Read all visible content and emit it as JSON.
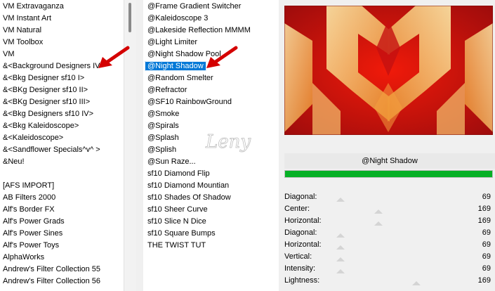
{
  "left_list": {
    "items": [
      "VM Extravaganza",
      "VM Instant Art",
      "VM Natural",
      "VM Toolbox",
      "VM",
      "&<Background Designers IV>",
      "&<Bkg Designer sf10 I>",
      "&<BKg Designer sf10 II>",
      "&<BKg Designer sf10 III>",
      "&<Bkg Designers sf10 IV>",
      "&<Bkg Kaleidoscope>",
      "&<Kaleidoscope>",
      "&<Sandflower Specials^v^ >",
      "&Neu!",
      "",
      "[AFS IMPORT]",
      "AB Filters 2000",
      "Alf's Border FX",
      "Alf's Power Grads",
      "Alf's Power Sines",
      "Alf's Power Toys",
      "AlphaWorks",
      "Andrew's Filter Collection 55",
      "Andrew's Filter Collection 56"
    ]
  },
  "middle_list": {
    "items": [
      "@Frame Gradient Switcher",
      "@Kaleidoscope 3",
      "@Lakeside Reflection MMMM",
      "@Light Limiter",
      "@Night Shadow Pool",
      "@Night Shadow",
      "@Random Smelter",
      "@Refractor",
      "@SF10 RainbowGround",
      "@Smoke",
      "@Spirals",
      "@Splash",
      "@Splish",
      "@Sun Raze...",
      "sf10 Diamond Flip",
      "sf10 Diamond Mountian",
      "sf10 Shades Of Shadow",
      "sf10 Sheer Curve",
      "sf10 Slice N Dice",
      "sf10 Square Bumps",
      "THE TWIST TUT"
    ],
    "selected_index": 5
  },
  "preview": {
    "filter_name": "@Night Shadow",
    "progress": 1,
    "colors": {
      "red": "#c41414",
      "bright_red": "#f01a0a",
      "cream": "#fbe39a",
      "orange": "#f4a040"
    }
  },
  "parameters": [
    {
      "label": "Diagonal:",
      "value": "69"
    },
    {
      "label": "Center:",
      "value": "169"
    },
    {
      "label": "Horizontal:",
      "value": "169"
    },
    {
      "label": "Diagonal:",
      "value": "69"
    },
    {
      "label": "Horizontal:",
      "value": "69"
    },
    {
      "label": "Vertical:",
      "value": "69"
    },
    {
      "label": "Intensity:",
      "value": "69"
    },
    {
      "label": "Lightness:",
      "value": "169"
    }
  ],
  "watermark_text": "Leny",
  "annotations": {
    "arrow_color": "#d40000",
    "arrow_icon": "red-pointer-arrow-icon"
  }
}
